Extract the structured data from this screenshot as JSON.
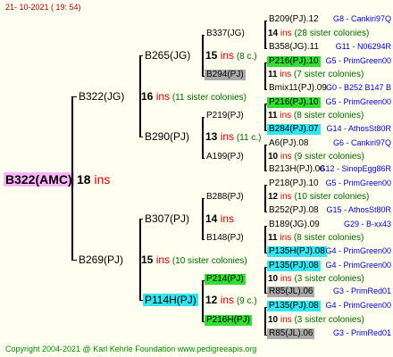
{
  "header": "21- 10-2021 ( 19: 54)",
  "footer": "Copyright 2004-2021 @ Karl Kehrle Foundation    www.pedigreeapis.org",
  "ins_label": "ins",
  "root": {
    "id": "B322(AMC)",
    "count": "18",
    "bg": "#ffb6ff"
  },
  "gen1": [
    {
      "id": "B322(JG)",
      "count": "16",
      "note": "(11 sister colonies)"
    },
    {
      "id": "B269(PJ)",
      "count": "15",
      "note": "(10 sister colonies)"
    }
  ],
  "gen2": [
    {
      "id": "B265(JG)",
      "count": "15",
      "note": "(8 c.)"
    },
    {
      "id": "B290(PJ)",
      "count": "13",
      "note": "(11 c.)"
    },
    {
      "id": "B307(PJ)",
      "count": "14",
      "note": ""
    },
    {
      "id": "P114H(PJ)",
      "count": "12",
      "note": "(9 c.)",
      "bg": "#33e5f0"
    }
  ],
  "gen3": [
    {
      "id": "B337(JG)",
      "count": "14",
      "note": "(28 sister colonies)"
    },
    {
      "id": "B294(PJ)",
      "count": "11",
      "note": "(7 sister colonies)",
      "bg": "#aaaaaa"
    },
    {
      "id": "P219(PJ)",
      "count": "11",
      "note": "(8 sister colonies)"
    },
    {
      "id": "A199(PJ)",
      "count": "10",
      "note": "(9 sister colonies)"
    },
    {
      "id": "B288(PJ)",
      "count": "12",
      "note": "(10 sister colonies)"
    },
    {
      "id": "B148(PJ)",
      "count": "11",
      "note": "(8 sister colonies)"
    },
    {
      "id": "P214(PJ)",
      "count": "10",
      "note": "(3 sister colonies)",
      "bg": "#33dd33"
    },
    {
      "id": "P216H(PJ)",
      "count": "10",
      "note": "(3 sister colonies)",
      "bg": "#33dd33"
    }
  ],
  "gen4": [
    {
      "id": "B209(PJ).12",
      "line": "G8 - Cankiri97Q"
    },
    {
      "id": "B358(JG).11",
      "line": "G11 - N06294R"
    },
    {
      "id": "P216(PJ).10",
      "line": "G5 - PrimGreen00",
      "bg": "#33dd33"
    },
    {
      "id": "Bmix11(PJ).09",
      "line": "G0 - B252 B147 B"
    },
    {
      "id": "P216(PJ).10",
      "line": "G5 - PrimGreen00",
      "bg": "#33dd33"
    },
    {
      "id": "B284(PJ).07",
      "line": "G14 - AthosSt80R",
      "bg": "#33e5f0"
    },
    {
      "id": "A6(PJ).08",
      "line": "G6 - Cankiri97Q"
    },
    {
      "id": "B213H(PJ).06",
      "line": "G12 - SinopEgg86R"
    },
    {
      "id": "P218(PJ).10",
      "line": "G5 - PrimGreen00"
    },
    {
      "id": "B252(PJ).08",
      "line": "G15 - AthosSt80R"
    },
    {
      "id": "B189(JG).09",
      "line": "G29 - B-xx43"
    },
    {
      "id": "P135H(PJ).08",
      "line": "G4 - PrimGreen00",
      "bg": "#33e5f0"
    },
    {
      "id": "P135(PJ).08",
      "line": "G4 - PrimGreen00",
      "bg": "#33e5f0"
    },
    {
      "id": "R85(JL).06",
      "line": "G3 - PrimRed01",
      "bg": "#aaaaaa"
    },
    {
      "id": "P135(PJ).08",
      "line": "G4 - PrimGreen00",
      "bg": "#33e5f0"
    },
    {
      "id": "R85(JL).06",
      "line": "G3 - PrimRed01",
      "bg": "#aaaaaa"
    }
  ]
}
